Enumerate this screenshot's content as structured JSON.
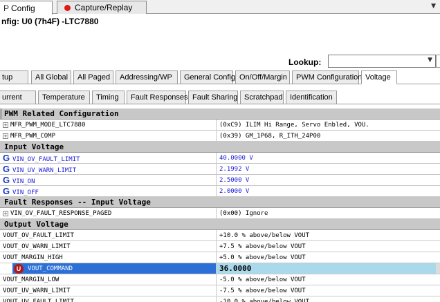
{
  "top_tabs": [
    {
      "label": "Config",
      "prefix": "P"
    },
    {
      "label": "Capture/Replay"
    }
  ],
  "title": "nfig: U0 (7h4F) -LTC7880",
  "lookup": {
    "label": "Lookup:",
    "value": ""
  },
  "tab_row1": [
    "tup",
    "All Global",
    "All Paged",
    "Addressing/WP",
    "General Config",
    "On/Off/Margin",
    "PWM Configuration",
    "Voltage"
  ],
  "tab_row2": [
    "urrent",
    "Temperature",
    "Timing",
    "Fault Responses",
    "Fault Sharing",
    "Scratchpad",
    "Identification"
  ],
  "active_tab": "Voltage",
  "grid": [
    {
      "kind": "section",
      "name": "PWM Related Configuration"
    },
    {
      "kind": "expand",
      "name": "MFR_PWM_MODE_LTC7880",
      "value": "(0xC9) ILIM Hi Range, Servo Enbled, VOU."
    },
    {
      "kind": "expand",
      "name": "MFR_PWM_COMP",
      "value": "(0x39) GM_1P68, R_ITH_24P00"
    },
    {
      "kind": "section",
      "name": "Input Voltage"
    },
    {
      "kind": "global",
      "name": "VIN_OV_FAULT_LIMIT",
      "value": "40.0000 V"
    },
    {
      "kind": "global",
      "name": "VIN_UV_WARN_LIMIT",
      "value": "2.1992 V"
    },
    {
      "kind": "global",
      "name": "VIN_ON",
      "value": "2.5000 V"
    },
    {
      "kind": "global",
      "name": "VIN_OFF",
      "value": "2.0000 V"
    },
    {
      "kind": "section",
      "name": "Fault Responses -- Input Voltage"
    },
    {
      "kind": "expand",
      "name": "VIN_OV_FAULT_RESPONSE_PAGED",
      "value": "(0x00) Ignore"
    },
    {
      "kind": "section",
      "name": "Output Voltage"
    },
    {
      "kind": "plain",
      "name": "VOUT_OV_FAULT_LIMIT",
      "value": "+10.0 % above/below VOUT"
    },
    {
      "kind": "plain",
      "name": "VOUT_OV_WARN_LIMIT",
      "value": "+7.5 % above/below VOUT"
    },
    {
      "kind": "plain",
      "name": "VOUT_MARGIN_HIGH",
      "value": "+5.0 % above/below VOUT"
    },
    {
      "kind": "selected",
      "name": "VOUT_COMMAND",
      "value": "36.0000",
      "badge": "U"
    },
    {
      "kind": "plain",
      "name": "VOUT_MARGIN_LOW",
      "value": "-5.0 % above/below VOUT"
    },
    {
      "kind": "plain",
      "name": "VOUT_UV_WARN_LIMIT",
      "value": "-7.5 % above/below VOUT"
    },
    {
      "kind": "plain",
      "name": "VOUT_UV_FAULT_LIMIT",
      "value": "-10.0 % above/below VOUT"
    }
  ],
  "colors": {
    "section_bg": "#c8c8c8",
    "global_text": "#1a1ad8",
    "selected_name_bg": "#2c6fd6",
    "selected_value_bg": "#a9d9ea",
    "record_dot": "#e01818",
    "badge": "#b01818"
  },
  "icons": {
    "global": "G",
    "expand": "plus-box-icon",
    "record": "record-dot-icon",
    "dropdown": "chevron-down-icon"
  }
}
